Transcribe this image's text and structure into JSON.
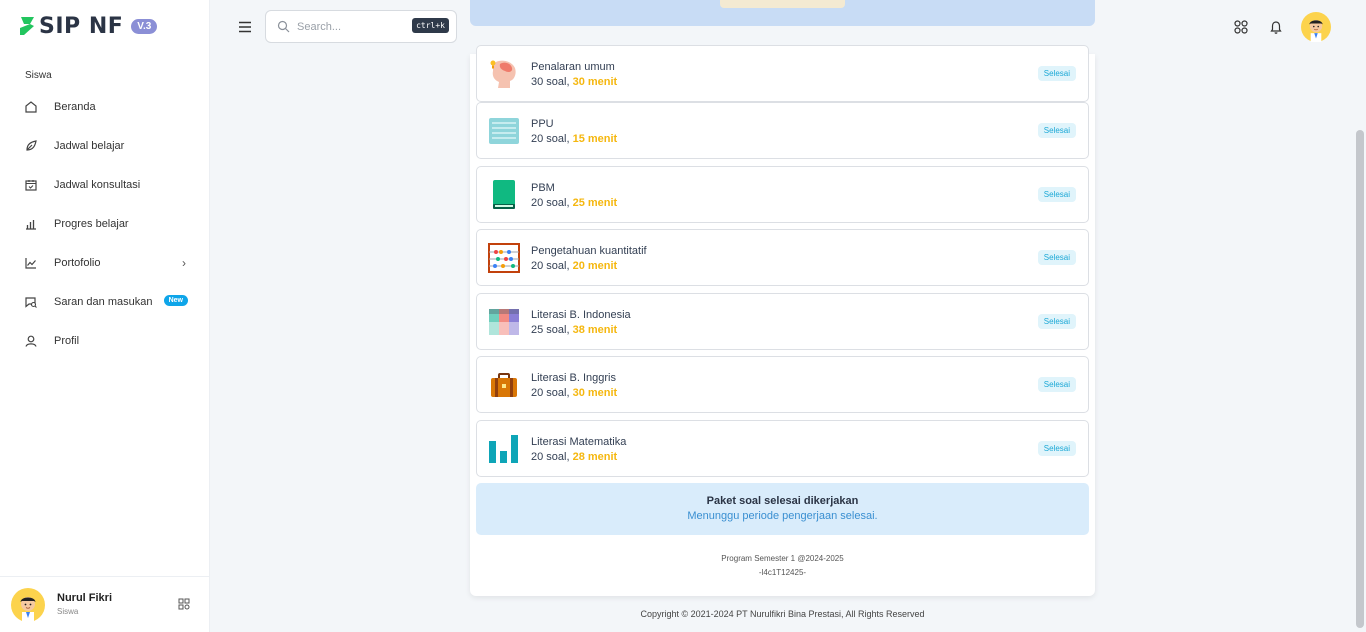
{
  "brand": {
    "name": "SIP NF",
    "version": "V.3",
    "accent": "#22c55e"
  },
  "sidebar": {
    "section": "Siswa",
    "items": [
      {
        "label": "Beranda",
        "icon": "home-icon"
      },
      {
        "label": "Jadwal belajar",
        "icon": "leaf-icon"
      },
      {
        "label": "Jadwal konsultasi",
        "icon": "calendar-check-icon"
      },
      {
        "label": "Progres belajar",
        "icon": "bar-chart-icon"
      },
      {
        "label": "Portofolio",
        "icon": "line-chart-icon",
        "chevron": "›"
      },
      {
        "label": "Saran dan masukan",
        "icon": "chat-search-icon",
        "badge": "New"
      },
      {
        "label": "Profil",
        "icon": "user-icon"
      }
    ]
  },
  "user": {
    "name": "Nurul Fikri",
    "role": "Siswa"
  },
  "topbar": {
    "search_placeholder": "Search...",
    "shortcut": "ctrl+k"
  },
  "subjects": [
    {
      "name": "Penalaran umum",
      "count": "30 soal,",
      "duration": "30 menit",
      "status": "Selesai",
      "icon": "brain-icon"
    },
    {
      "name": "PPU",
      "count": "20 soal,",
      "duration": "15 menit",
      "status": "Selesai",
      "icon": "document-icon"
    },
    {
      "name": "PBM",
      "count": "20 soal,",
      "duration": "25 menit",
      "status": "Selesai",
      "icon": "book-icon"
    },
    {
      "name": "Pengetahuan kuantitatif",
      "count": "20 soal,",
      "duration": "20 menit",
      "status": "Selesai",
      "icon": "abacus-icon"
    },
    {
      "name": "Literasi B. Indonesia",
      "count": "25 soal,",
      "duration": "38 menit",
      "status": "Selesai",
      "icon": "palette-icon"
    },
    {
      "name": "Literasi B. Inggris",
      "count": "20 soal,",
      "duration": "30 menit",
      "status": "Selesai",
      "icon": "suitcase-icon"
    },
    {
      "name": "Literasi Matematika",
      "count": "20 soal,",
      "duration": "28 menit",
      "status": "Selesai",
      "icon": "bar-chart-icon"
    }
  ],
  "completion": {
    "title": "Paket soal selesai dikerjakan",
    "subtitle": "Menunggu periode pengerjaan selesai."
  },
  "footer": {
    "program": "Program Semester 1 @2024-2025",
    "code": "-l4c1T12425-",
    "copyright": "Copyright © 2021-2024 PT Nurulfikri Bina Prestasi, All Rights Reserved"
  }
}
